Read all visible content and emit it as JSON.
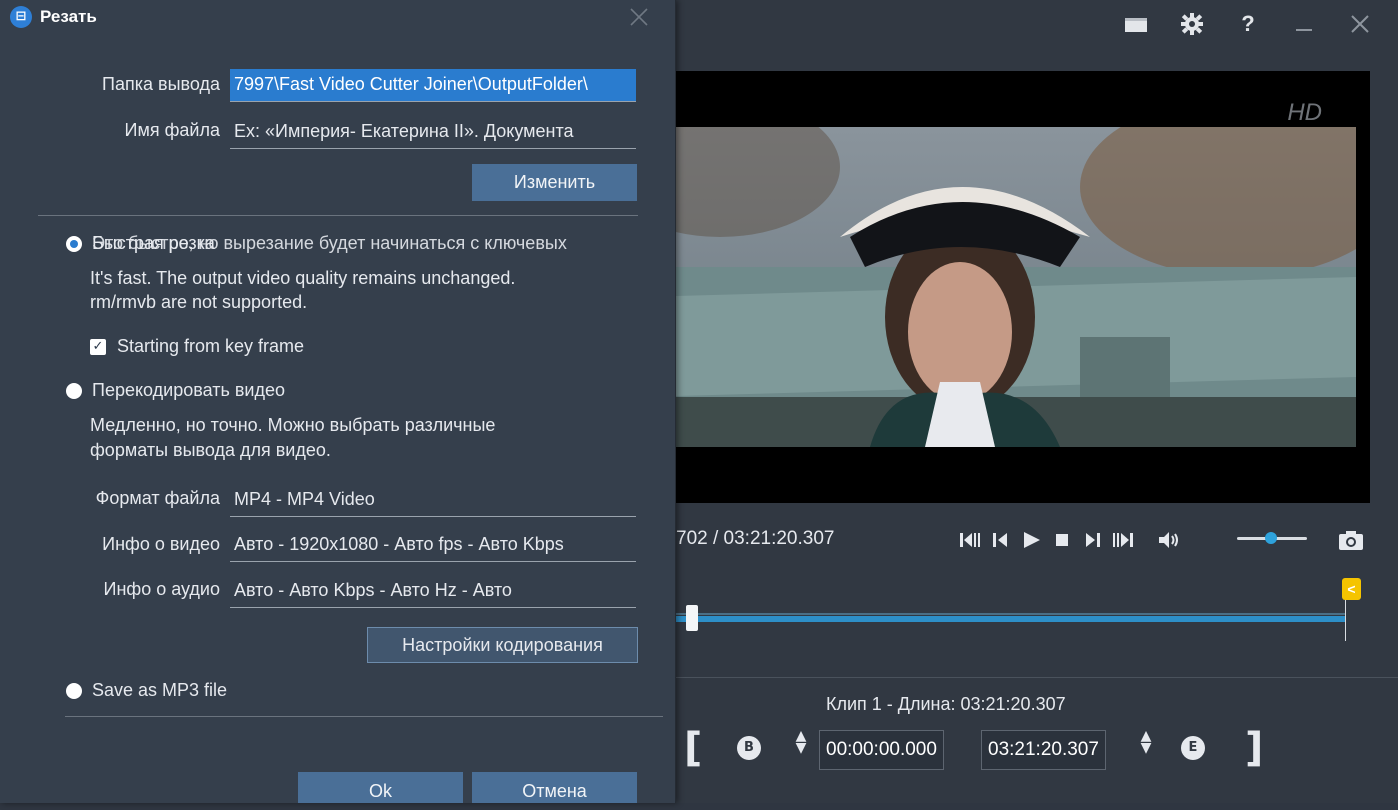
{
  "main_window": {
    "top_icons": [
      "folder-icon",
      "gear-icon",
      "help-icon",
      "minimize-icon",
      "close-icon"
    ],
    "time_display": "702 / 03:21:20.307",
    "channel_logo": "HD",
    "clip_info": "Клип 1 - Длина: 03:21:20.307",
    "start_time": "00:00:00.000",
    "end_time": "03:21:20.307",
    "begin_marker_label": "B",
    "end_marker_label": "E",
    "end_flag_label": "<",
    "bracket_open": "[",
    "bracket_close": "]"
  },
  "dialog": {
    "title": "Резать",
    "app_icon_glyph": "⊟",
    "output_folder_label": "Папка вывода",
    "output_folder_value": "7997\\Fast Video Cutter Joiner\\OutputFolder\\",
    "file_name_label": "Имя файла",
    "file_name_value": "Ex: «Империя- Екатерина II». Документа",
    "change_button": "Изменить",
    "fast_cut_label": "Быстрая резка",
    "fast_cut_overlap": "Это быстро, но вырезание будет начинаться с ключевых",
    "fast_desc_line1": "It's fast. The output video quality remains unchanged.",
    "fast_desc_line2": "rm/rmvb are not supported.",
    "keyframe_checkbox_label": "Starting from key frame",
    "reencode_label": "Перекодировать видео",
    "reencode_desc_line1": "Медленно, но точно. Можно выбрать различные",
    "reencode_desc_line2": "форматы вывода для видео.",
    "format_label": "Формат файла",
    "format_value": "MP4 - MP4 Video",
    "video_info_label": "Инфо о видео",
    "video_info_value": "Авто - 1920x1080 - Авто fps - Авто Kbps",
    "audio_info_label": "Инфо о аудио",
    "audio_info_value": "Авто - Авто Kbps - Авто Hz - Авто",
    "encoding_settings_button": "Настройки кодирования",
    "mp3_label": "Save as MP3 file",
    "ok_button": "Ok",
    "cancel_button": "Отмена"
  },
  "colors": {
    "accent": "#2a7ccf",
    "button": "#4a6f97",
    "dialog_bg": "#353f4c",
    "window_bg": "#313842",
    "marker_yellow": "#f5c400"
  }
}
